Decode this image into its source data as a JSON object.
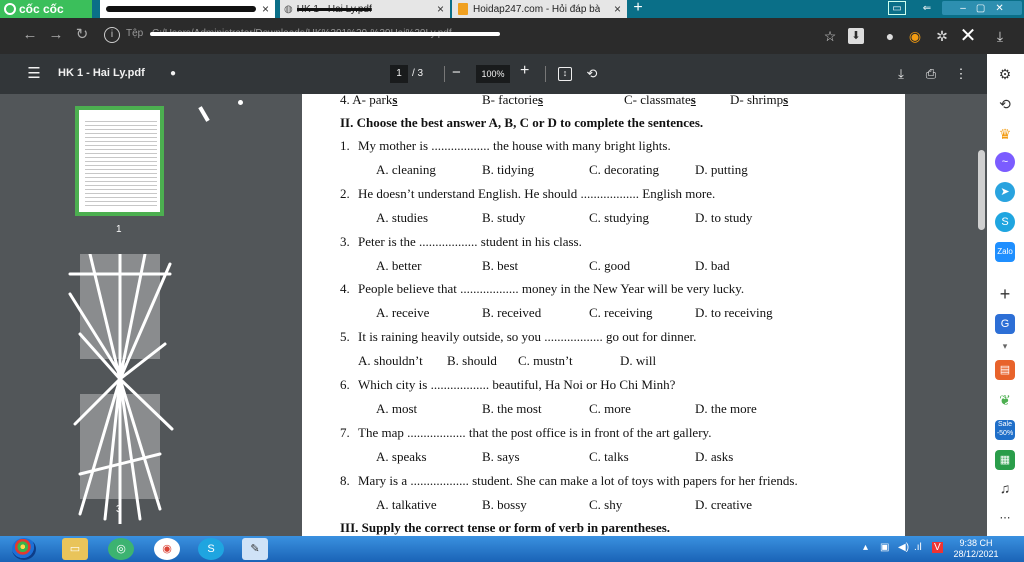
{
  "browser": {
    "brand": "cốc cốc",
    "tabs": [
      {
        "label": "",
        "active": true
      },
      {
        "label": "HK 1 - Hai Ly.pdf",
        "active": false
      },
      {
        "label": "Hoidap247.com - Hỏi đáp bà",
        "active": false
      }
    ],
    "url_prefix": "Tệp",
    "url": "C:/Users/Administrator/Downloads/HK%201%20-%20Hai%20Ly.pdf"
  },
  "pdf_toolbar": {
    "title": "HK 1 - Hai Ly.pdf",
    "page_current": "1",
    "page_total": "/ 3",
    "zoom": "100%"
  },
  "thumbnails": {
    "pages": [
      "1",
      "3"
    ]
  },
  "document": {
    "prev_line": {
      "num": "4. A- park",
      "opts": [
        "s",
        "B- factorie",
        "s",
        "C- classmate",
        "s",
        "D- shrimp",
        "s"
      ]
    },
    "section_ii": "II. Choose the best answer A, B, C or D to  complete the sentences.",
    "questions": [
      {
        "num": "1.",
        "text": "My mother is .................. the house with many bright lights.",
        "options": [
          "A. cleaning",
          "B. tidying",
          "C. decorating",
          "D. putting"
        ]
      },
      {
        "num": "2.",
        "text": "He doesn’t understand English. He should .................. English more.",
        "options": [
          "A. studies",
          "B. study",
          "C. studying",
          "D. to study"
        ]
      },
      {
        "num": "3.",
        "text": "Peter is the .................. student in his class.",
        "options": [
          "A. better",
          "B. best",
          "C. good",
          "D. bad"
        ]
      },
      {
        "num": "4.",
        "text": "People believe that .................. money in the New Year will be very lucky.",
        "options": [
          "A. receive",
          "B. received",
          "C. receiving",
          "D. to receiving"
        ]
      },
      {
        "num": "5.",
        "text": "It is raining heavily outside, so you .................. go out for dinner.",
        "options": [
          "A. shouldn’t",
          "B. should",
          "C. mustn’t",
          "D. will"
        ]
      },
      {
        "num": "6.",
        "text": "Which city is .................. beautiful, Ha Noi or Ho Chi Minh?",
        "options": [
          "A. most",
          "B. the most",
          "C. more",
          "D. the more"
        ]
      },
      {
        "num": "7.",
        "text": "The map .................. that the post office is in front of the art gallery.",
        "options": [
          "A. speaks",
          "B. says",
          "C. talks",
          "D. asks"
        ]
      },
      {
        "num": "8.",
        "text": "Mary is a .................. student. She can make a lot of toys with papers for her friends.",
        "options": [
          "A. talkative",
          "B. bossy",
          "C. shy",
          "D. creative"
        ]
      }
    ],
    "section_iii": "III. Supply the correct tense or form of verb in parentheses."
  },
  "taskbar": {
    "time": "9:38 CH",
    "date": "28/12/2021"
  },
  "colors": {
    "tabstrip": "#0a6f88",
    "brand": "#3bbf5b",
    "thumb_active_border": "#4caf50",
    "pdf_toolbar": "#323639",
    "viewer_bg": "#525659"
  }
}
